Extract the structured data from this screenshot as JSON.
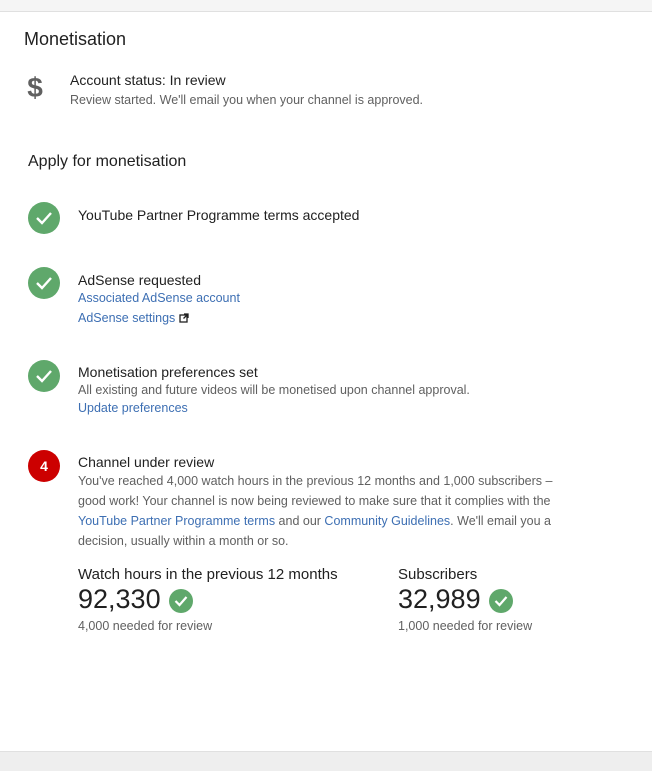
{
  "card": {
    "title": "Monetisation",
    "status": {
      "icon": "dollar-icon",
      "symbol": "$",
      "label": "Account status: In review",
      "sub": "Review started. We'll email you when your channel is approved."
    }
  },
  "apply": {
    "title": "Apply for monetisation",
    "step1": {
      "title": "YouTube Partner Programme terms accepted"
    },
    "step2": {
      "title": "AdSense requested",
      "link1": "Associated AdSense account",
      "link2": "AdSense settings"
    },
    "step3": {
      "title": "Monetisation preferences set",
      "desc": "All existing and future videos will be monetised upon channel approval.",
      "link": "Update preferences"
    },
    "step4": {
      "number": "4",
      "title": "Channel under review",
      "para_a": "You've reached 4,000 watch hours in the previous 12 months and 1,000 subscribers – good work! Your channel is now being reviewed to make sure that it complies with the ",
      "para_link1": "YouTube Partner Programme terms",
      "para_b": " and our ",
      "para_link2": "Community Guidelines",
      "para_c": ". We'll email you a decision, usually within a month or so."
    }
  },
  "metrics": {
    "watch": {
      "label": "Watch hours in the previous 12 months",
      "value": "92,330",
      "needed": "4,000 needed for review"
    },
    "subs": {
      "label": "Subscribers",
      "value": "32,989",
      "needed": "1,000 needed for review"
    }
  },
  "colors": {
    "check": "#5fa86b",
    "step_number": "#cc0000",
    "link": "#3d6fb3"
  }
}
